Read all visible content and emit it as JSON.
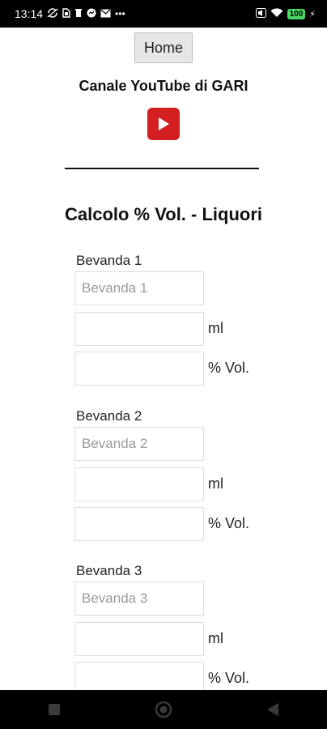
{
  "status_bar": {
    "time": "13:14",
    "left_icons": [
      "sync-off-icon",
      "sim-card-icon",
      "trash-icon",
      "messenger-icon",
      "mail-icon",
      "more-dots-icon"
    ],
    "right_icons": [
      "mute-icon",
      "wifi-icon",
      "battery-icon",
      "charging-bolt-icon"
    ],
    "battery": "100"
  },
  "header": {
    "home_label": "Home",
    "channel_title": "Canale YouTube di GARI",
    "youtube_icon": "youtube-play-icon",
    "youtube_color": "#d31f1f"
  },
  "page_title": "Calcolo % Vol. - Liquori",
  "drinks": [
    {
      "label": "Bevanda 1",
      "name_placeholder": "Bevanda 1",
      "ml_value": "",
      "vol_value": ""
    },
    {
      "label": "Bevanda 2",
      "name_placeholder": "Bevanda 2",
      "ml_value": "",
      "vol_value": ""
    },
    {
      "label": "Bevanda 3",
      "name_placeholder": "Bevanda 3",
      "ml_value": "",
      "vol_value": ""
    }
  ],
  "units": {
    "ml": "ml",
    "vol": "% Vol."
  },
  "nav_bar": {
    "icons": [
      "recents-square-icon",
      "home-circle-icon",
      "back-triangle-icon"
    ]
  }
}
